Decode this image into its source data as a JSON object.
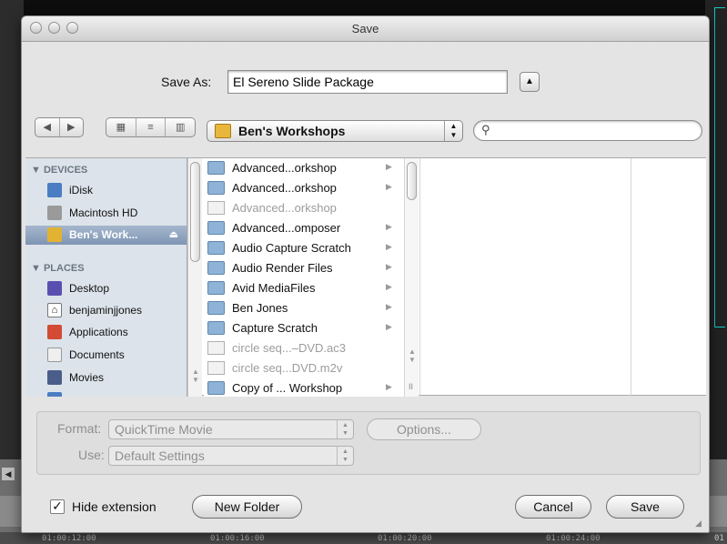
{
  "window": {
    "title": "Save"
  },
  "save_as": {
    "label": "Save As:",
    "value": "El Sereno Slide Package"
  },
  "toolbar": {
    "nav": [
      "◀",
      "▶"
    ],
    "views": [
      "icon-view",
      "list-view",
      "column-view"
    ],
    "location": "Ben's Workshops",
    "search_placeholder": ""
  },
  "sidebar": {
    "devices_heading": "DEVICES",
    "devices": [
      {
        "label": "iDisk",
        "icon": "idisk-icon",
        "color": "#4a7dc3"
      },
      {
        "label": "Macintosh HD",
        "icon": "hard-drive-icon",
        "color": "#9a9a9a"
      },
      {
        "label": "Ben's Work...",
        "icon": "disk-image-icon",
        "color": "#e2b233"
      }
    ],
    "places_heading": "PLACES",
    "places": [
      {
        "label": "Desktop",
        "icon": "desktop-icon",
        "color": "#5a4fb0"
      },
      {
        "label": "benjaminjjones",
        "icon": "home-icon",
        "color": "#ffffff"
      },
      {
        "label": "Applications",
        "icon": "applications-icon",
        "color": "#d34a35"
      },
      {
        "label": "Documents",
        "icon": "documents-icon",
        "color": "#efefef"
      },
      {
        "label": "Movies",
        "icon": "movies-icon",
        "color": "#4b5d8a"
      }
    ]
  },
  "files": [
    {
      "name": "Advanced...orkshop",
      "type": "folder",
      "dim": false,
      "arrow": "▶"
    },
    {
      "name": "Advanced...orkshop",
      "type": "folder",
      "dim": false,
      "arrow": "▶"
    },
    {
      "name": "Advanced...orkshop",
      "type": "doc",
      "dim": true,
      "arrow": ""
    },
    {
      "name": "Advanced...omposer",
      "type": "folder",
      "dim": false,
      "arrow": "▶"
    },
    {
      "name": "Audio Capture Scratch",
      "type": "folder",
      "dim": false,
      "arrow": "▶"
    },
    {
      "name": "Audio Render Files",
      "type": "folder",
      "dim": false,
      "arrow": "▶"
    },
    {
      "name": "Avid MediaFiles",
      "type": "folder",
      "dim": false,
      "arrow": "▶"
    },
    {
      "name": "Ben Jones",
      "type": "folder",
      "dim": false,
      "arrow": "▶"
    },
    {
      "name": "Capture Scratch",
      "type": "folder",
      "dim": false,
      "arrow": "▶"
    },
    {
      "name": "circle seq...–DVD.ac3",
      "type": "doc",
      "dim": true,
      "arrow": ""
    },
    {
      "name": "circle seq...DVD.m2v",
      "type": "doc",
      "dim": true,
      "arrow": ""
    },
    {
      "name": "Copy of ... Workshop",
      "type": "folder",
      "dim": false,
      "arrow": "▶"
    }
  ],
  "format": {
    "format_label": "Format:",
    "format_value": "QuickTime Movie",
    "options_label": "Options...",
    "use_label": "Use:",
    "use_value": "Default Settings"
  },
  "bottom": {
    "hide_extension": "Hide extension",
    "hide_checked": "✓",
    "new_folder": "New Folder",
    "cancel": "Cancel",
    "save": "Save"
  },
  "background": {
    "timecodes": [
      "01:00:12:00",
      "01:00:16:00",
      "01:00:20:00",
      "01:00:24:00",
      "01"
    ]
  }
}
